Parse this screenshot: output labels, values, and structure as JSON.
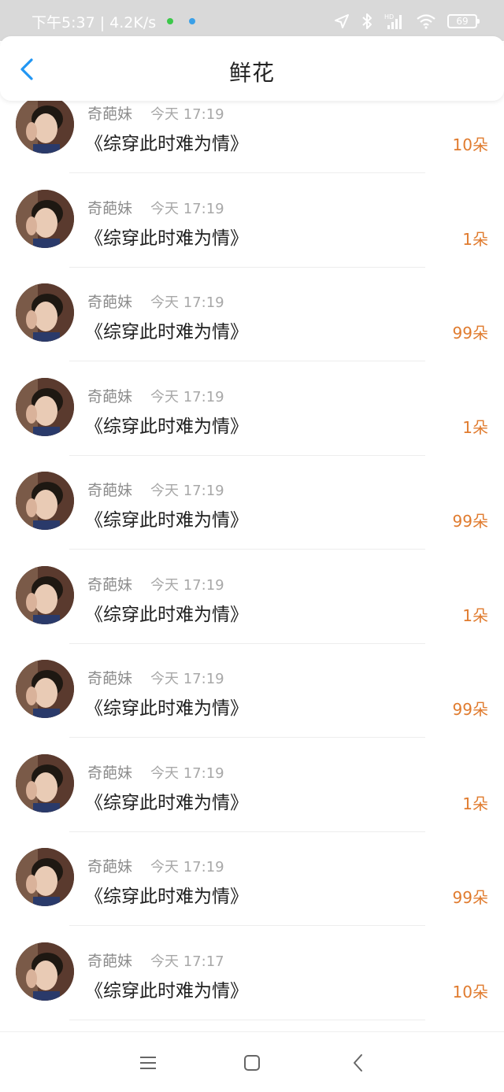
{
  "status_bar": {
    "left_text": "下午5:37 | 4.2K/s",
    "battery": "69",
    "dot_colors": [
      "#3cc84a",
      "#3aa0e8"
    ]
  },
  "header": {
    "title": "鲜花",
    "back_icon": "chevron-left-icon",
    "accent_color": "#2196f3"
  },
  "list": {
    "items": [
      {
        "name": "奇葩妹",
        "time": "今天 17:19",
        "book": "《综穿此时难为情》",
        "count": "10朵"
      },
      {
        "name": "奇葩妹",
        "time": "今天 17:19",
        "book": "《综穿此时难为情》",
        "count": "1朵"
      },
      {
        "name": "奇葩妹",
        "time": "今天 17:19",
        "book": "《综穿此时难为情》",
        "count": "99朵"
      },
      {
        "name": "奇葩妹",
        "time": "今天 17:19",
        "book": "《综穿此时难为情》",
        "count": "1朵"
      },
      {
        "name": "奇葩妹",
        "time": "今天 17:19",
        "book": "《综穿此时难为情》",
        "count": "99朵"
      },
      {
        "name": "奇葩妹",
        "time": "今天 17:19",
        "book": "《综穿此时难为情》",
        "count": "1朵"
      },
      {
        "name": "奇葩妹",
        "time": "今天 17:19",
        "book": "《综穿此时难为情》",
        "count": "99朵"
      },
      {
        "name": "奇葩妹",
        "time": "今天 17:19",
        "book": "《综穿此时难为情》",
        "count": "1朵"
      },
      {
        "name": "奇葩妹",
        "time": "今天 17:19",
        "book": "《综穿此时难为情》",
        "count": "99朵"
      },
      {
        "name": "奇葩妹",
        "time": "今天 17:17",
        "book": "《综穿此时难为情》",
        "count": "10朵"
      }
    ],
    "count_color": "#e07b2e"
  },
  "nav_bar": {
    "icons": [
      "menu-icon",
      "home-square-icon",
      "back-chevron-icon"
    ]
  }
}
